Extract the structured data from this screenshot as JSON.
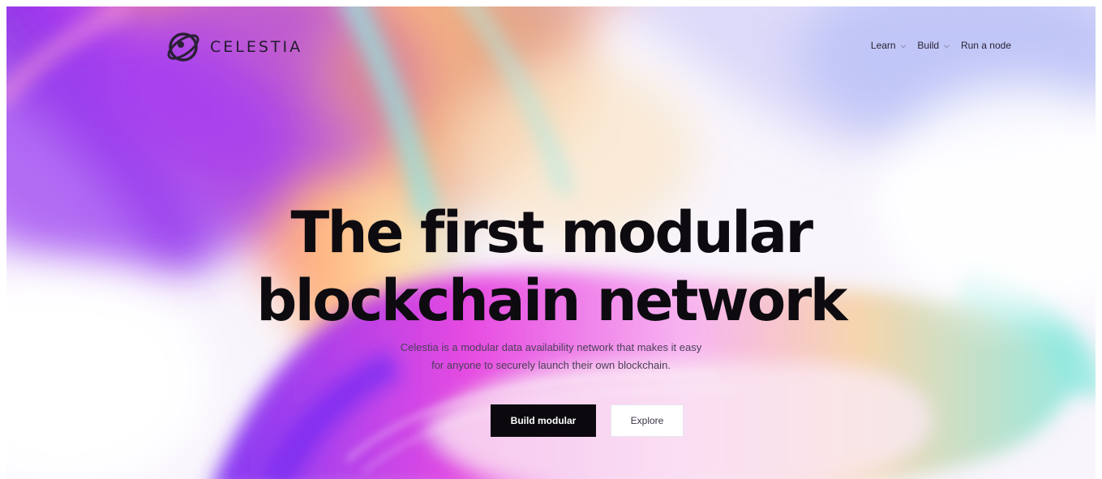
{
  "header": {
    "brand": "CELESTIA",
    "nav": [
      {
        "label": "Learn",
        "has_dropdown": true
      },
      {
        "label": "Build",
        "has_dropdown": true
      },
      {
        "label": "Run a node",
        "has_dropdown": false
      }
    ]
  },
  "hero": {
    "title_line1": "The first modular",
    "title_line2": "blockchain network",
    "subtitle_line1": "Celestia is a modular data availability network that makes it easy",
    "subtitle_line2": "for anyone to securely launch their own blockchain.",
    "primary_cta": "Build modular",
    "secondary_cta": "Explore"
  },
  "icons": {
    "logo": "celestia-logo-icon",
    "chevron": "chevron-down-icon"
  },
  "colors": {
    "violet": "#8a2be2",
    "magenta": "#e53fe0",
    "orange": "#f6a36a",
    "cyan": "#8fe7e0",
    "text_dark": "#0d0b10",
    "button_dark": "#0b090e"
  }
}
